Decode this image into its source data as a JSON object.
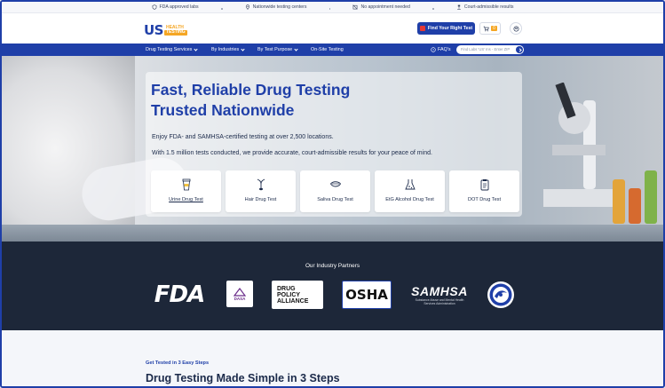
{
  "topbar": {
    "items": [
      {
        "icon": "shield-icon",
        "label": "FDA approved labs"
      },
      {
        "icon": "location-pin-icon",
        "label": "Nationwide testing centers"
      },
      {
        "icon": "calendar-off-icon",
        "label": "No appointment needed"
      },
      {
        "icon": "gavel-icon",
        "label": "Court-admissible results"
      }
    ]
  },
  "header": {
    "logo_main": "US",
    "logo_health": "HEALTH",
    "logo_testing": "TESTING",
    "find_test_label": "Find Your Right Test",
    "cart_count": "0"
  },
  "nav": {
    "items": [
      {
        "label": "Drug Testing Services",
        "dropdown": true
      },
      {
        "label": "By Industries",
        "dropdown": true
      },
      {
        "label": "By Test Purpose",
        "dropdown": true
      },
      {
        "label": "On-Site Testing",
        "dropdown": false
      }
    ],
    "faq_label": "FAQ's",
    "zip_placeholder": "Find Labs 'US' Ins - Enter ZIP"
  },
  "hero": {
    "title_line1": "Fast, Reliable Drug Testing",
    "title_line2": "Trusted Nationwide",
    "para1": "Enjoy FDA- and SAMHSA-certified testing at over 2,500 locations.",
    "para2": "With 1.5 million tests conducted, we provide accurate, court-admissible results for your peace of mind.",
    "tests": [
      {
        "label": "Urine Drug Test",
        "icon": "urine-cup-icon"
      },
      {
        "label": "Hair Drug Test",
        "icon": "hair-follicle-icon"
      },
      {
        "label": "Saliva Drug Test",
        "icon": "saliva-mouth-icon"
      },
      {
        "label": "EtG Alcohol Drug Test",
        "icon": "lab-flask-icon"
      },
      {
        "label": "DOT Drug Test",
        "icon": "clipboard-icon"
      }
    ]
  },
  "partners": {
    "title": "Our Industry Partners",
    "fda": "FDA",
    "dasa": "DASA",
    "dpa_line1": "DRUG",
    "dpa_line2": "POLICY",
    "dpa_line3": "ALLIANCE",
    "osha": "OSHA",
    "samhsa": "SAMHSA",
    "samhsa_sub1": "Substance Abuse and Mental Health",
    "samhsa_sub2": "Services Administration"
  },
  "steps": {
    "kicker": "Get Tested in 3 Easy Steps",
    "title": "Drug Testing Made Simple in 3 Steps"
  }
}
